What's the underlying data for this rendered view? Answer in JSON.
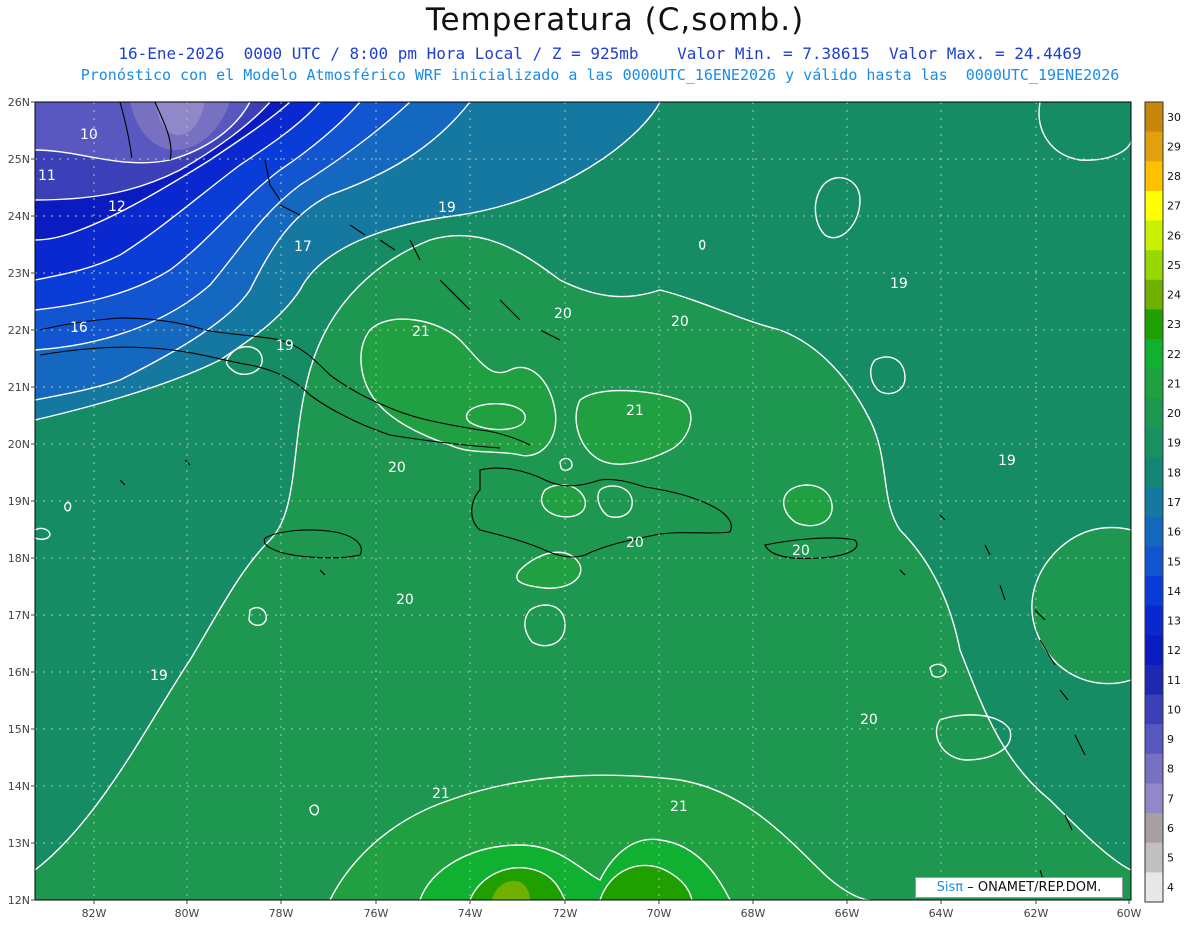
{
  "header": {
    "title": "Temperatura (C,somb.)",
    "line1": "16-Ene-2026  0000 UTC / 8:00 pm Hora Local / Z = 925mb    Valor Min. = 7.38615  Valor Max. = 24.4469",
    "line2": "Pronóstico con el Modelo Atmosférico WRF inicializado a las 0000UTC_16ENE2026 y válido hasta las  0000UTC_19ENE2026"
  },
  "map": {
    "lat_ticks": [
      "26N",
      "25N",
      "24N",
      "23N",
      "22N",
      "21N",
      "20N",
      "19N",
      "18N",
      "17N",
      "16N",
      "15N",
      "14N",
      "13N",
      "12N"
    ],
    "lon_ticks": [
      "82W",
      "80W",
      "78W",
      "76W",
      "74W",
      "72W",
      "70W",
      "68W",
      "66W",
      "64W",
      "62W",
      "60W"
    ],
    "contour_labels": [
      {
        "text": "10"
      },
      {
        "text": "11"
      },
      {
        "text": "12"
      },
      {
        "text": "17"
      },
      {
        "text": "19"
      },
      {
        "text": "16"
      },
      {
        "text": "19"
      },
      {
        "text": "21"
      },
      {
        "text": "20"
      },
      {
        "text": "20"
      },
      {
        "text": "21"
      },
      {
        "text": "19"
      },
      {
        "text": "20"
      },
      {
        "text": "19"
      },
      {
        "text": "20"
      },
      {
        "text": "20"
      },
      {
        "text": "20"
      },
      {
        "text": "19"
      },
      {
        "text": "20"
      },
      {
        "text": "21"
      },
      {
        "text": "21"
      }
    ],
    "colorbar": {
      "labels": [
        "30",
        "29",
        "28",
        "27",
        "26",
        "25",
        "24",
        "23",
        "22",
        "21",
        "20",
        "19",
        "18",
        "17",
        "16",
        "15",
        "14",
        "13",
        "12",
        "11",
        "10",
        "9",
        "8",
        "7",
        "6",
        "5",
        "4"
      ],
      "colors": [
        "#c8860a",
        "#e0a010",
        "#ffc000",
        "#ffff00",
        "#c8f000",
        "#98d800",
        "#70b000",
        "#20a000",
        "#10b030",
        "#20a040",
        "#1e9850",
        "#189060",
        "#158575",
        "#1478a0",
        "#1468c0",
        "#1255d0",
        "#0a3cd8",
        "#0a28d0",
        "#0a1cc0",
        "#1e28b0",
        "#3c40b8",
        "#5858c0",
        "#7870c0",
        "#9088c8",
        "#a8a0a0",
        "#c0c0c0",
        "#e8e8e8"
      ]
    }
  },
  "credit": {
    "brand": "Sisπ",
    "text": "– ONAMET/REP.DOM."
  }
}
